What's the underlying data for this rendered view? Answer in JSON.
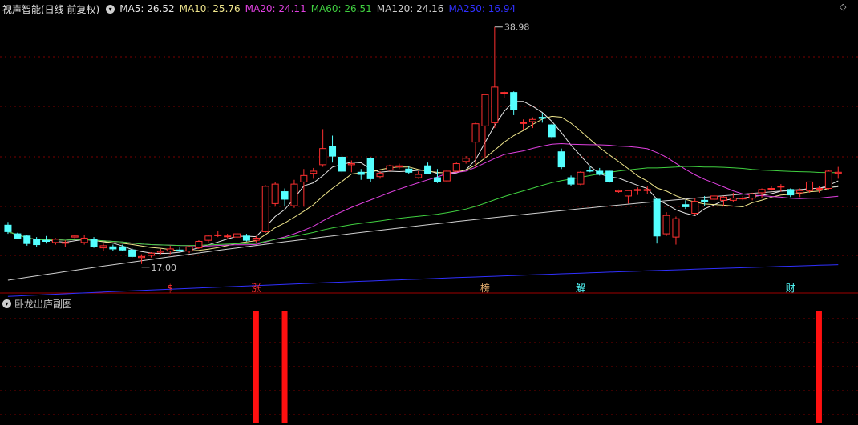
{
  "header": {
    "title": "视声智能(日线 前复权)",
    "indicators": [
      {
        "label": "MA5: 26.52",
        "color": "#e6e6e6"
      },
      {
        "label": "MA10: 25.76",
        "color": "#f0e68c"
      },
      {
        "label": "MA20: 24.11",
        "color": "#e040e0"
      },
      {
        "label": "MA60: 26.51",
        "color": "#40d040"
      },
      {
        "label": "MA120: 24.16",
        "color": "#d0d0d0"
      },
      {
        "label": "MA250: 16.94",
        "color": "#3030ff"
      }
    ]
  },
  "sub_panel": {
    "title": "卧龙出庐副图"
  },
  "colors": {
    "up": "#ff3030",
    "down": "#54ffff",
    "grid": "#7a0000",
    "ma5": "#e6e6e6",
    "ma10": "#f0e68c",
    "ma20": "#e040e0",
    "ma60": "#40d040",
    "ma120": "#d0d0d0",
    "ma250": "#3030ff"
  },
  "chart_data": {
    "type": "candlestick",
    "price_range": [
      15.5,
      40.0
    ],
    "annotations": {
      "high_label": "38.98",
      "low_label": "17.00"
    },
    "event_markers": [
      {
        "index": 17,
        "text": "$",
        "color": "#ff3030"
      },
      {
        "index": 26,
        "text": "涨",
        "color": "#ff3030"
      },
      {
        "index": 50,
        "text": "榜",
        "color": "#e8b070"
      },
      {
        "index": 60,
        "text": "解",
        "color": "#54ffff"
      },
      {
        "index": 82,
        "text": "财",
        "color": "#54ffff"
      }
    ],
    "candles": [
      [
        20.6,
        20.9,
        19.8,
        20.0
      ],
      [
        19.8,
        19.9,
        19.3,
        19.4
      ],
      [
        19.6,
        19.7,
        18.7,
        18.9
      ],
      [
        19.3,
        19.5,
        18.6,
        18.8
      ],
      [
        19.2,
        19.6,
        18.9,
        19.1
      ],
      [
        19.0,
        19.4,
        18.8,
        19.3
      ],
      [
        19.0,
        19.2,
        18.6,
        19.0
      ],
      [
        19.5,
        19.7,
        19.3,
        19.6
      ],
      [
        19.0,
        19.7,
        18.8,
        19.4
      ],
      [
        19.3,
        19.5,
        18.5,
        18.6
      ],
      [
        18.5,
        18.9,
        18.2,
        18.7
      ],
      [
        18.6,
        18.8,
        18.2,
        18.4
      ],
      [
        18.6,
        18.8,
        18.2,
        18.3
      ],
      [
        18.3,
        18.5,
        17.6,
        17.7
      ],
      [
        17.6,
        17.9,
        17.0,
        17.7
      ],
      [
        17.8,
        18.1,
        17.6,
        18.0
      ],
      [
        18.1,
        18.4,
        17.9,
        18.2
      ],
      [
        18.2,
        18.7,
        17.9,
        18.4
      ],
      [
        18.3,
        18.6,
        18.1,
        18.2
      ],
      [
        18.2,
        18.7,
        18.0,
        18.6
      ],
      [
        18.5,
        19.2,
        18.4,
        19.1
      ],
      [
        19.2,
        19.7,
        19.0,
        19.6
      ],
      [
        19.7,
        20.1,
        19.5,
        19.7
      ],
      [
        19.6,
        19.8,
        19.4,
        19.6
      ],
      [
        19.5,
        19.9,
        19.4,
        19.8
      ],
      [
        19.6,
        19.8,
        19.1,
        19.2
      ],
      [
        19.2,
        19.6,
        19.0,
        19.4
      ],
      [
        20.0,
        24.3,
        19.9,
        24.2
      ],
      [
        22.6,
        24.6,
        22.4,
        24.4
      ],
      [
        23.7,
        24.0,
        22.4,
        23.0
      ],
      [
        22.4,
        24.8,
        22.2,
        24.4
      ],
      [
        24.6,
        25.8,
        22.4,
        25.2
      ],
      [
        25.4,
        25.9,
        24.9,
        25.6
      ],
      [
        26.2,
        29.5,
        26.0,
        27.7
      ],
      [
        27.9,
        28.9,
        26.4,
        27.0
      ],
      [
        26.9,
        27.2,
        25.4,
        25.6
      ],
      [
        26.2,
        26.6,
        25.5,
        26.3
      ],
      [
        25.5,
        25.8,
        24.8,
        25.3
      ],
      [
        26.8,
        26.9,
        24.6,
        24.9
      ],
      [
        25.1,
        25.6,
        24.9,
        25.4
      ],
      [
        25.7,
        26.2,
        25.6,
        26.1
      ],
      [
        26.0,
        26.3,
        25.8,
        26.1
      ],
      [
        25.8,
        26.1,
        25.3,
        25.5
      ],
      [
        25.0,
        25.6,
        24.9,
        25.3
      ],
      [
        26.1,
        26.4,
        25.3,
        25.4
      ],
      [
        25.0,
        25.8,
        24.5,
        24.6
      ],
      [
        24.7,
        25.7,
        24.6,
        25.6
      ],
      [
        25.6,
        26.4,
        25.5,
        26.3
      ],
      [
        26.5,
        27.0,
        26.3,
        26.8
      ],
      [
        28.3,
        30.1,
        25.9,
        30.0
      ],
      [
        29.8,
        32.8,
        26.8,
        32.7
      ],
      [
        30.1,
        38.98,
        29.6,
        33.4
      ],
      [
        32.9,
        33.0,
        32.4,
        32.9
      ],
      [
        32.9,
        33.0,
        30.8,
        31.3
      ],
      [
        30.1,
        30.4,
        29.4,
        30.1
      ],
      [
        30.2,
        30.6,
        29.6,
        30.4
      ],
      [
        30.6,
        31.0,
        30.1,
        30.5
      ],
      [
        29.9,
        30.0,
        28.6,
        28.8
      ],
      [
        27.4,
        27.7,
        25.8,
        26.0
      ],
      [
        25.0,
        25.2,
        24.2,
        24.4
      ],
      [
        24.4,
        25.6,
        24.3,
        25.5
      ],
      [
        25.7,
        26.0,
        25.5,
        25.6
      ],
      [
        25.6,
        25.9,
        25.2,
        25.3
      ],
      [
        25.6,
        25.7,
        24.5,
        24.6
      ],
      [
        23.7,
        23.9,
        23.6,
        23.8
      ],
      [
        23.3,
        23.8,
        22.6,
        23.8
      ],
      [
        23.8,
        24.1,
        23.4,
        23.9
      ],
      [
        23.8,
        24.2,
        23.5,
        23.9
      ],
      [
        23.0,
        23.0,
        18.9,
        19.6
      ],
      [
        19.8,
        21.8,
        19.6,
        21.5
      ],
      [
        19.5,
        21.4,
        18.8,
        21.2
      ],
      [
        22.5,
        22.9,
        22.1,
        22.3
      ],
      [
        21.7,
        23.1,
        21.5,
        22.8
      ],
      [
        22.9,
        23.3,
        22.4,
        22.8
      ],
      [
        23.0,
        23.4,
        22.8,
        23.3
      ],
      [
        22.9,
        23.3,
        22.4,
        23.2
      ],
      [
        22.9,
        23.6,
        22.7,
        23.1
      ],
      [
        23.1,
        23.3,
        22.9,
        23.1
      ],
      [
        23.1,
        23.6,
        22.9,
        23.5
      ],
      [
        23.6,
        24.0,
        23.1,
        23.9
      ],
      [
        24.0,
        24.2,
        23.8,
        24.0
      ],
      [
        24.2,
        24.4,
        23.7,
        24.2
      ],
      [
        23.9,
        24.0,
        23.2,
        23.4
      ],
      [
        23.6,
        24.0,
        23.2,
        23.8
      ],
      [
        23.8,
        24.6,
        23.6,
        24.6
      ],
      [
        24.0,
        24.2,
        23.6,
        24.0
      ],
      [
        24.0,
        25.7,
        23.9,
        25.6
      ],
      [
        25.4,
        26.0,
        24.9,
        25.5
      ]
    ],
    "sub_bars": [
      26,
      29,
      85
    ]
  }
}
